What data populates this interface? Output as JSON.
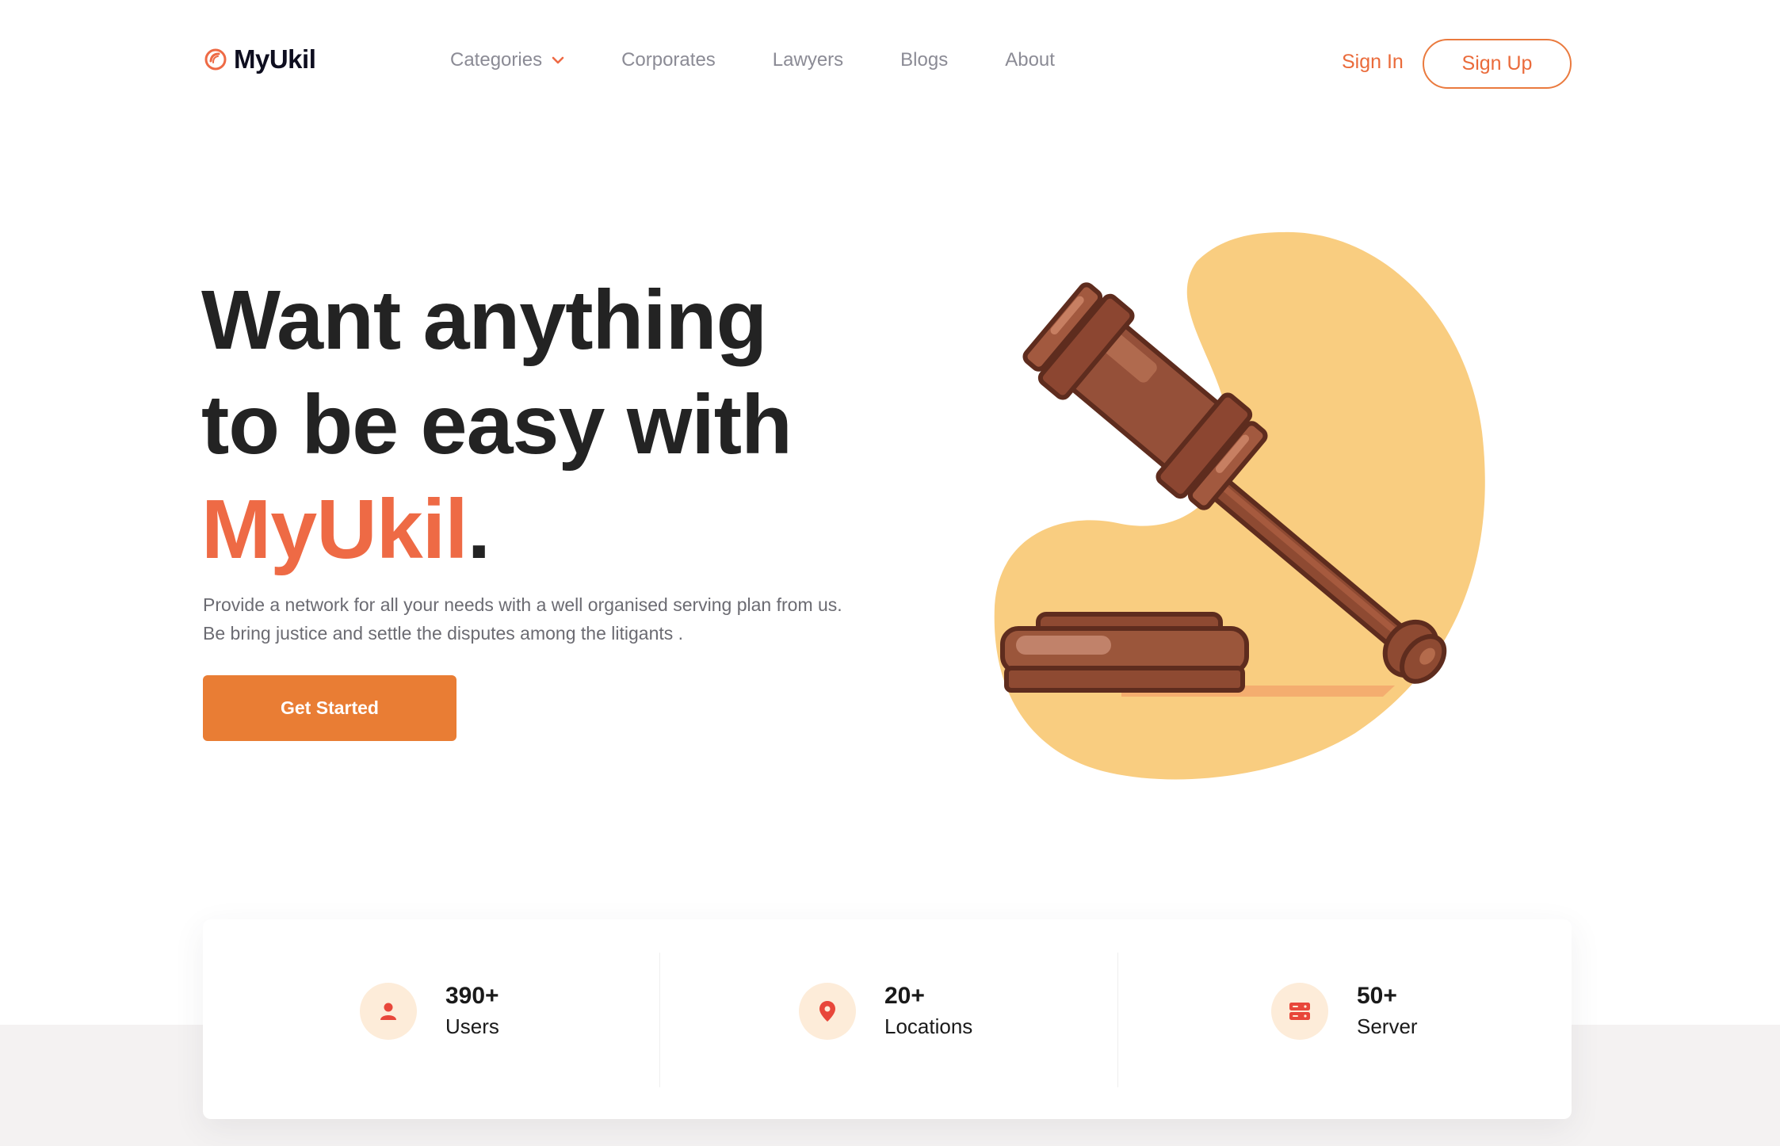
{
  "brand": {
    "name": "MyUkil",
    "accent_color": "#ee6a45",
    "cta_color": "#e97d34"
  },
  "nav": {
    "items": [
      {
        "label": "Categories",
        "has_dropdown": true
      },
      {
        "label": "Corporates"
      },
      {
        "label": "Lawyers"
      },
      {
        "label": "Blogs"
      },
      {
        "label": "About"
      }
    ],
    "sign_in": "Sign In",
    "sign_up": "Sign Up"
  },
  "hero": {
    "title_line1": "Want anything",
    "title_line2": "to be easy with",
    "title_brand": "MyUkil",
    "title_suffix": ".",
    "description": "Provide a network for all your needs with a well organised serving plan from us. Be bring justice and settle the disputes among the litigants .",
    "cta_label": "Get Started",
    "illustration": "gavel-icon"
  },
  "stats": [
    {
      "value": "390+",
      "label": "Users",
      "icon": "user-icon"
    },
    {
      "value": "20+",
      "label": "Locations",
      "icon": "location-pin-icon"
    },
    {
      "value": "50+",
      "label": "Server",
      "icon": "server-icon"
    }
  ]
}
